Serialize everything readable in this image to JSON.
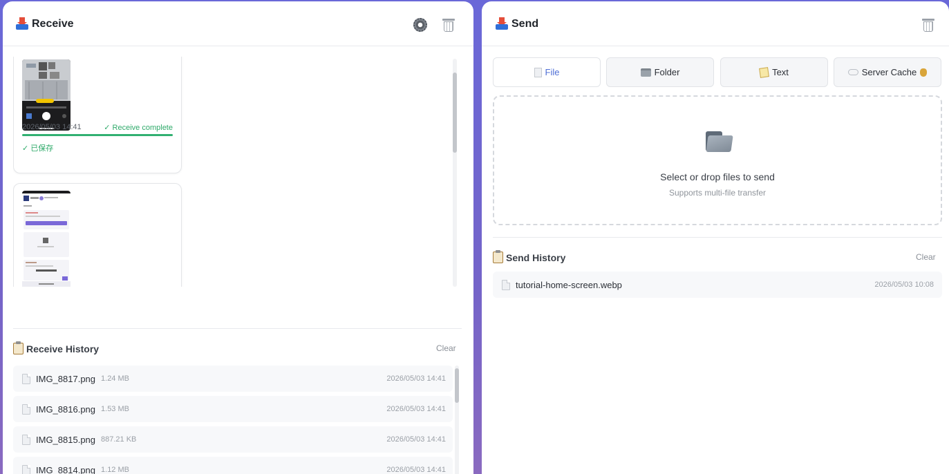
{
  "receive": {
    "title": "Receive",
    "cards": [
      {
        "time": "2026/05/03 14:41",
        "status": "✓ Receive complete",
        "saved": "✓ 已保存",
        "progress": 1.0
      }
    ],
    "history": {
      "title": "Receive History",
      "clear_label": "Clear",
      "items": [
        {
          "name": "IMG_8817.png",
          "size": "1.24 MB",
          "time": "2026/05/03 14:41"
        },
        {
          "name": "IMG_8816.png",
          "size": "1.53 MB",
          "time": "2026/05/03 14:41"
        },
        {
          "name": "IMG_8815.png",
          "size": "887.21 KB",
          "time": "2026/05/03 14:41"
        },
        {
          "name": "IMG_8814.png",
          "size": "1.12 MB",
          "time": "2026/05/03 14:41"
        }
      ]
    }
  },
  "send": {
    "title": "Send",
    "tabs": [
      {
        "label": "File",
        "icon": "file-icon",
        "active": true
      },
      {
        "label": "Folder",
        "icon": "folder-icon",
        "active": false
      },
      {
        "label": "Text",
        "icon": "memo-icon",
        "active": false
      },
      {
        "label": "Server Cache",
        "icon": "cloud-icon",
        "active": false
      }
    ],
    "dropzone": {
      "title": "Select or drop files to send",
      "subtitle": "Supports multi-file transfer"
    },
    "history": {
      "title": "Send History",
      "clear_label": "Clear",
      "items": [
        {
          "name": "tutorial-home-screen.webp",
          "time": "2026/05/03 10:08"
        }
      ]
    }
  },
  "colors": {
    "accent": "#4f6fd6",
    "success": "#2faa6a",
    "background": "#6a68d8"
  }
}
